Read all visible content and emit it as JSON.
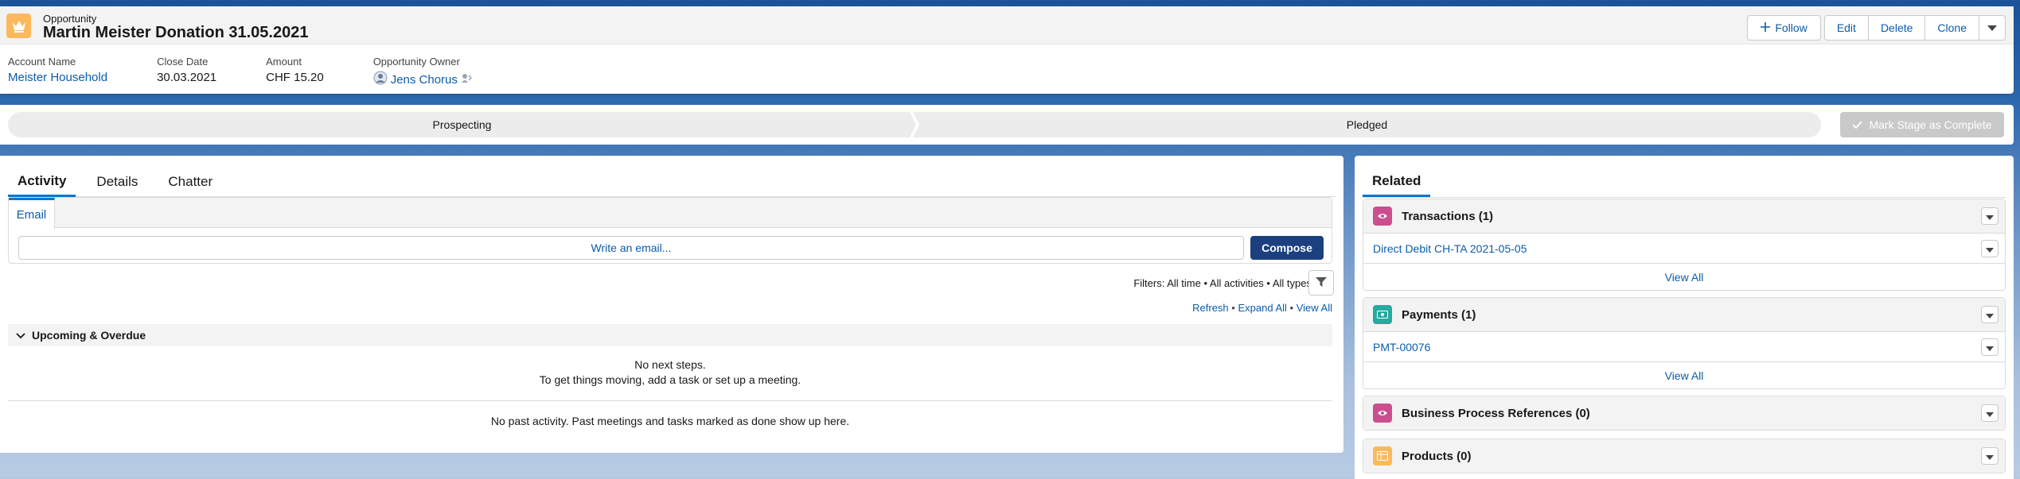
{
  "header": {
    "record_type": "Opportunity",
    "title": "Martin Meister Donation 31.05.2021",
    "buttons": {
      "follow": "Follow",
      "edit": "Edit",
      "delete": "Delete",
      "clone": "Clone"
    },
    "fields": {
      "account_label": "Account Name",
      "account_value": "Meister Household",
      "close_label": "Close Date",
      "close_value": "30.03.2021",
      "amount_label": "Amount",
      "amount_value": "CHF 15.20",
      "owner_label": "Opportunity Owner",
      "owner_value": "Jens Chorus"
    }
  },
  "path": {
    "stages": [
      "Prospecting",
      "Pledged"
    ],
    "mark_button": "Mark Stage as Complete"
  },
  "main": {
    "tabs": [
      "Activity",
      "Details",
      "Chatter"
    ],
    "active_tab": "Activity",
    "email_tab": "Email",
    "email_placeholder": "Write an email...",
    "compose": "Compose",
    "filters": "Filters: All time • All activities • All types",
    "links": {
      "refresh": "Refresh",
      "expand_all": "Expand All",
      "view_all": "View All"
    },
    "upcoming_title": "Upcoming & Overdue",
    "no_steps_line1": "No next steps.",
    "no_steps_line2": "To get things moving, add a task or set up a meeting.",
    "no_past": "No past activity. Past meetings and tasks marked as done show up here."
  },
  "related": {
    "tab": "Related",
    "lists": [
      {
        "title": "Transactions (1)",
        "icon": "transaction-icon",
        "color": "#cb4f8e",
        "row": "Direct Debit CH-TA 2021-05-05",
        "footer": "View All"
      },
      {
        "title": "Payments (1)",
        "icon": "payment-icon",
        "color": "#26ab9f",
        "row": "PMT-00076",
        "footer": "View All"
      },
      {
        "title": "Business Process References (0)",
        "icon": "process-icon",
        "color": "#cb4f8e"
      },
      {
        "title": "Products (0)",
        "icon": "product-icon",
        "color": "#fcb95b"
      }
    ]
  },
  "colors": {
    "brand": "#0176d3",
    "link": "#0b5cab",
    "compose_bg": "#1b3f7f",
    "opportunity_icon": "#fcb95b"
  }
}
